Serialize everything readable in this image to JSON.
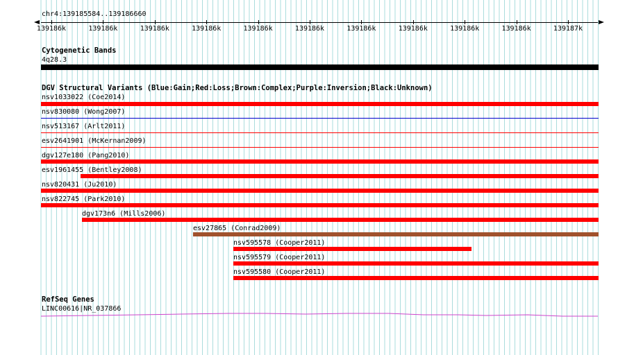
{
  "ruler": {
    "position_text": "chr4:139185584..139186660",
    "tick_labels": [
      "139186k",
      "139186k",
      "139186k",
      "139186k",
      "139186k",
      "139186k",
      "139186k",
      "139186k",
      "139186k",
      "139186k",
      "139187k"
    ]
  },
  "cytogenetic": {
    "title": "Cytogenetic Bands",
    "band_label": "4q28.3",
    "color": "#000000"
  },
  "dgv": {
    "title": "DGV Structural Variants (Blue:Gain;Red:Loss;Brown:Complex;Purple:Inversion;Black:Unknown)",
    "colors": {
      "loss": "#ff0000",
      "gain": "#0000cc",
      "complex": "#a0522d"
    },
    "features": [
      {
        "label": "nsv1033022 (Coe2014)",
        "color": "#ff0000"
      },
      {
        "label": "nsv830080 (Wong2007)",
        "color": "#0000cc"
      },
      {
        "label": "nsv513167 (Arlt2011)",
        "color": "#ff0000"
      },
      {
        "label": "esv2641901 (McKernan2009)",
        "color": "#ff0000"
      },
      {
        "label": "dgv127e180 (Pang2010)",
        "color": "#ff0000"
      },
      {
        "label": "esv1961455 (Bentley2008)",
        "color": "#ff0000"
      },
      {
        "label": "nsv820431 (Ju2010)",
        "color": "#ff0000"
      },
      {
        "label": "nsv822745 (Park2010)",
        "color": "#ff0000"
      },
      {
        "label": "dgv173n6 (Mills2006)",
        "color": "#ff0000"
      },
      {
        "label": "esv27865 (Conrad2009)",
        "color": "#a0522d"
      },
      {
        "label": "nsv595578 (Cooper2011)",
        "color": "#ff0000"
      },
      {
        "label": "nsv595579 (Cooper2011)",
        "color": "#ff0000"
      },
      {
        "label": "nsv595580 (Cooper2011)",
        "color": "#ff0000"
      }
    ]
  },
  "refseq": {
    "title": "RefSeq Genes",
    "gene_label": "LINC00616|NR_037866",
    "color": "#cc44cc"
  }
}
